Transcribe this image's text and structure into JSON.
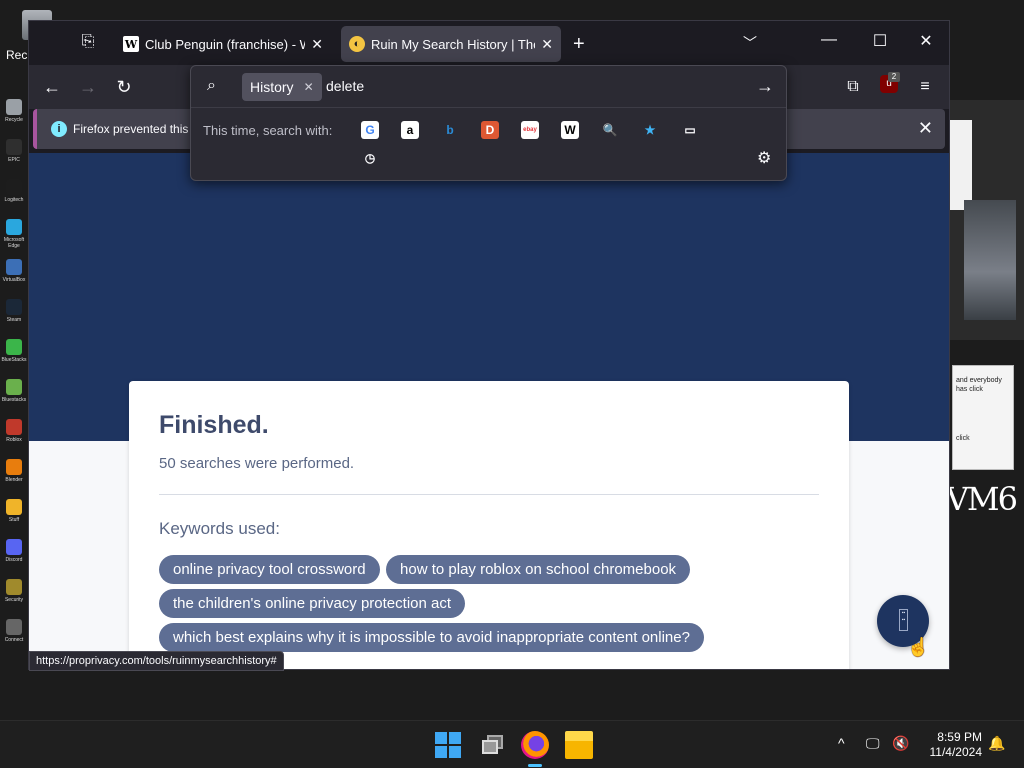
{
  "desktop": {
    "recycle_label": "Rec",
    "icons": [
      {
        "label": "Recycle",
        "color": "#9aa0a6"
      },
      {
        "label": "EPIC",
        "color": "#2f2f2f"
      },
      {
        "label": "Logitech",
        "color": "#1d1d1d"
      },
      {
        "label": "Microsoft Edge",
        "color": "#2aa7de"
      },
      {
        "label": "VirtualBox",
        "color": "#3c6fb6"
      },
      {
        "label": "Steam",
        "color": "#1b2838"
      },
      {
        "label": "BlueStacks",
        "color": "#3bb54a"
      },
      {
        "label": "Bluestacks",
        "color": "#6ab04c"
      },
      {
        "label": "Roblox",
        "color": "#c0392b"
      },
      {
        "label": "Blender",
        "color": "#e87d0d"
      },
      {
        "label": "Stuff",
        "color": "#f0b429"
      },
      {
        "label": "Discord",
        "color": "#5865f2"
      },
      {
        "label": "Security",
        "color": "#a08a2c"
      },
      {
        "label": "Connect",
        "color": "#666666"
      }
    ],
    "sticky_line1": "and everybody has click",
    "sticky_line2": "click",
    "scrawl": "VM6"
  },
  "browser": {
    "tabs": [
      {
        "title": "Club Penguin (franchise) - Wiki",
        "favicon": "W",
        "active": false
      },
      {
        "title": "Ruin My Search History | The ar",
        "favicon": "◐",
        "active": true
      }
    ],
    "new_tab": "+",
    "tab_list": "⌄",
    "window_controls": {
      "minimize": "—",
      "maximize": "☐",
      "close": "✕"
    },
    "nav": {
      "back": "←",
      "forward": "→",
      "reload": "↻"
    },
    "extensions_badge": "2",
    "ublock_label": "u",
    "notification": "Firefox prevented this s",
    "notification_close": "✕",
    "status_url": "https://proprivacy.com/tools/ruinmysearchhistory#"
  },
  "urlbar": {
    "search_icon": "🔍",
    "scope_chip": "History",
    "scope_chip_close": "✕",
    "value": "delete",
    "go_icon": "→",
    "this_time_label": "This time, search with:",
    "engines": [
      {
        "name": "Google",
        "glyph": "G",
        "color": "#fbfbfe",
        "bg": "#ffffff",
        "fg": "#4285f4"
      },
      {
        "name": "Amazon",
        "glyph": "a",
        "color": "#000",
        "bg": "#ffffff",
        "fg": "#000000"
      },
      {
        "name": "Bing",
        "glyph": "b",
        "color": "#2a8bd6",
        "bg": "transparent",
        "fg": "#2a8bd6"
      },
      {
        "name": "DuckDuckGo",
        "glyph": "D",
        "color": "#de5833",
        "bg": "#de5833",
        "fg": "#ffffff"
      },
      {
        "name": "eBay",
        "glyph": "ebay",
        "color": "#e53238",
        "bg": "#ffffff",
        "fg": "#e53238"
      },
      {
        "name": "Wikipedia",
        "glyph": "W",
        "color": "#000",
        "bg": "#ffffff",
        "fg": "#000000"
      },
      {
        "name": "Search",
        "glyph": "🔍",
        "color": "#3b5bdb",
        "bg": "transparent",
        "fg": "#3b5bdb"
      },
      {
        "name": "Bookmarks",
        "glyph": "★",
        "color": "#3fb4f5",
        "bg": "transparent",
        "fg": "#3fb4f5"
      },
      {
        "name": "Tabs",
        "glyph": "▭",
        "color": "#fbfbfe",
        "bg": "transparent",
        "fg": "#fbfbfe"
      },
      {
        "name": "History",
        "glyph": "◷",
        "color": "#fbfbfe",
        "bg": "transparent",
        "fg": "#fbfbfe"
      }
    ],
    "settings_icon": "⚙"
  },
  "page": {
    "title": "Finished.",
    "subtitle": "50 searches were performed.",
    "keywords_heading": "Keywords used:",
    "keywords": [
      "online privacy tool crossword",
      "how to play roblox on school chromebook",
      "the children's online privacy protection act",
      "which best explains why it is impossible to avoid inappropriate content online?"
    ],
    "colors": {
      "hero": "#1e3460",
      "chip": "#5e6e94",
      "title": "#3e4a6b"
    }
  },
  "taskbar": {
    "time": "8:59 PM",
    "date": "11/4/2024",
    "tray_chevron": "^",
    "tray_display": "🖵",
    "tray_volume": "🔇",
    "notification_bell": "🔔"
  }
}
